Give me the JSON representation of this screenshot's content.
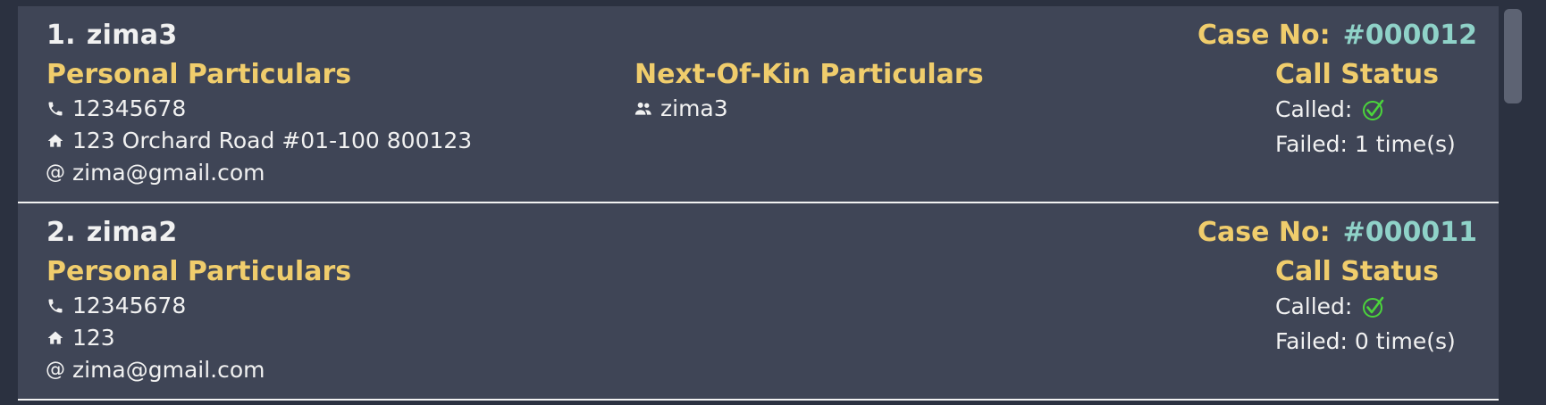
{
  "list": {
    "items": [
      {
        "index": "1.",
        "name": "zima3",
        "case_label": "Case No:",
        "case_number": "#000012",
        "personal_heading": "Personal Particulars",
        "phone": "12345678",
        "address": "123 Orchard Road #01-100 800123",
        "email": "zima@gmail.com",
        "next_of_kin_heading": "Next-Of-Kin Particulars",
        "next_of_kin_name": "zima3",
        "call_status_heading": "Call Status",
        "called_label": "Called:",
        "called": true,
        "failed_text": "Failed: 1 time(s)"
      },
      {
        "index": "2.",
        "name": "zima2",
        "case_label": "Case No:",
        "case_number": "#000011",
        "personal_heading": "Personal Particulars",
        "phone": "12345678",
        "address": "123",
        "email": "zima@gmail.com",
        "call_status_heading": "Call Status",
        "called_label": "Called:",
        "called": true,
        "failed_text": "Failed: 0 time(s)"
      }
    ]
  },
  "icons": {
    "phone": "phone-icon",
    "address": "home-icon",
    "email": "at-sign-icon",
    "next_of_kin": "people-icon",
    "called": "checkmark-icon"
  },
  "colors": {
    "background": "#2b3140",
    "card": "#3f4556",
    "heading": "#f0cd6c",
    "case_number": "#8fd2c8",
    "text": "#f1f1f1",
    "check": "#4bd43b"
  }
}
